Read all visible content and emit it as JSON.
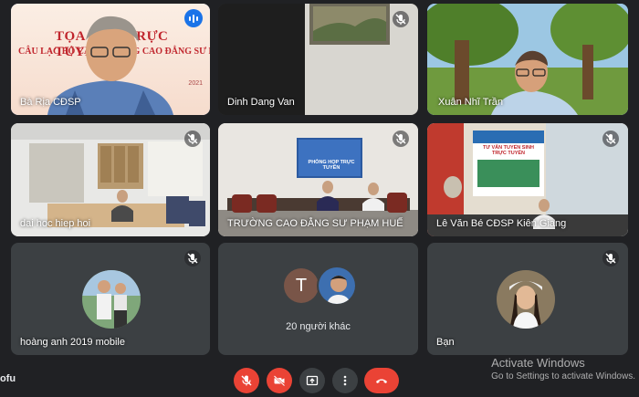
{
  "slide": {
    "line1": "TỌA ĐÀM TRỰC TUYẾN",
    "line2": "CÂU LẠC BỘ CÁC TRƯỜNG CAO ĐẲNG SƯ PHẠM",
    "year": "2021"
  },
  "tiles": [
    {
      "name": "Bà Rịa CĐSP"
    },
    {
      "name": "Dinh Dang Van"
    },
    {
      "name": "Xuân Nhĩ Trần"
    },
    {
      "name": "dai hoc hiep hoi"
    },
    {
      "name": "TRƯỜNG CAO ĐẲNG SƯ PHẠM HUẾ"
    },
    {
      "name": "Lê Văn Bé CĐSP Kiên Giang"
    },
    {
      "name": "hoàng anh 2019 mobile"
    },
    {
      "name": "",
      "others_label": "20 người khác",
      "avatar_letter": "T"
    },
    {
      "name": "Bạn"
    }
  ],
  "room_sign": {
    "title": "PHÒNG HỌP TRỰC TUYẾN"
  },
  "poster": {
    "title": "TƯ VẤN TUYỂN SINH TRỰC TUYẾN"
  },
  "user_name": "ofu",
  "activate": {
    "title": "Activate Windows",
    "sub": "Go to Settings to activate Windows."
  },
  "colors": {
    "accent": "#8ab4f8",
    "end_call": "#ea4335",
    "speaking": "#1a73e8"
  }
}
